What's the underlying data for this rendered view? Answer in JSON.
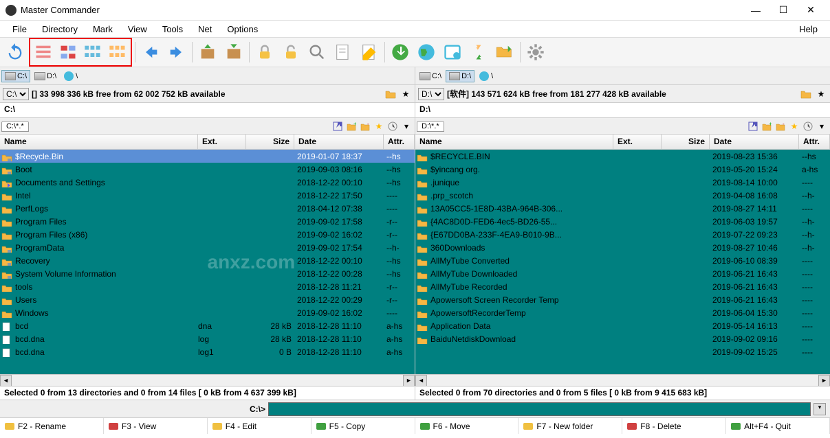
{
  "app": {
    "title": "Master Commander"
  },
  "menu": [
    "File",
    "Directory",
    "Mark",
    "View",
    "Tools",
    "Net",
    "Options"
  ],
  "menuRight": "Help",
  "left": {
    "drives": [
      {
        "label": "C:\\",
        "active": true
      },
      {
        "label": "D:\\",
        "active": false
      },
      {
        "label": "\\",
        "active": false,
        "net": true
      }
    ],
    "driveSel": "C:\\",
    "free": "[] 33 998 336 kB free from 62 002 752 kB available",
    "bread": "C:\\",
    "tab": "C:\\*.*",
    "cols": {
      "name": "Name",
      "ext": "Ext.",
      "size": "Size",
      "date": "Date",
      "attr": "Attr."
    },
    "rows": [
      {
        "icon": "folder-sys",
        "name": "$Recycle.Bin",
        "ext": "",
        "size": "<Dir>",
        "date": "2019-01-07 18:37",
        "attr": "--hs",
        "sel": true
      },
      {
        "icon": "folder-sys",
        "name": "Boot",
        "ext": "",
        "size": "<Dir>",
        "date": "2019-09-03 08:16",
        "attr": "--hs"
      },
      {
        "icon": "folder-link",
        "name": "Documents and Settings",
        "ext": "",
        "size": "<Link>",
        "date": "2018-12-22 00:10",
        "attr": "--hs"
      },
      {
        "icon": "folder",
        "name": "Intel",
        "ext": "",
        "size": "<Dir>",
        "date": "2018-12-22 17:50",
        "attr": "----"
      },
      {
        "icon": "folder",
        "name": "PerfLogs",
        "ext": "",
        "size": "<Dir>",
        "date": "2018-04-12 07:38",
        "attr": "----"
      },
      {
        "icon": "folder",
        "name": "Program Files",
        "ext": "",
        "size": "<Dir>",
        "date": "2019-09-02 17:58",
        "attr": "-r--"
      },
      {
        "icon": "folder",
        "name": "Program Files (x86)",
        "ext": "",
        "size": "<Dir>",
        "date": "2019-09-02 16:02",
        "attr": "-r--"
      },
      {
        "icon": "folder-sys",
        "name": "ProgramData",
        "ext": "",
        "size": "<Dir>",
        "date": "2019-09-02 17:54",
        "attr": "--h-"
      },
      {
        "icon": "folder-sys",
        "name": "Recovery",
        "ext": "",
        "size": "<Dir>",
        "date": "2018-12-22 00:10",
        "attr": "--hs"
      },
      {
        "icon": "folder-sys",
        "name": "System Volume Information",
        "ext": "",
        "size": "<Dir>",
        "date": "2018-12-22 00:28",
        "attr": "--hs"
      },
      {
        "icon": "folder",
        "name": "tools",
        "ext": "",
        "size": "<Dir>",
        "date": "2018-12-28 11:21",
        "attr": "-r--"
      },
      {
        "icon": "folder",
        "name": "Users",
        "ext": "",
        "size": "<Dir>",
        "date": "2018-12-22 00:29",
        "attr": "-r--"
      },
      {
        "icon": "folder",
        "name": "Windows",
        "ext": "",
        "size": "<Dir>",
        "date": "2019-09-02 16:02",
        "attr": "----"
      },
      {
        "icon": "file",
        "name": "bcd",
        "ext": "dna",
        "size": "28 kB",
        "date": "2018-12-28 11:10",
        "attr": "a-hs"
      },
      {
        "icon": "file",
        "name": "bcd.dna",
        "ext": "log",
        "size": "28 kB",
        "date": "2018-12-28 11:10",
        "attr": "a-hs"
      },
      {
        "icon": "file",
        "name": "bcd.dna",
        "ext": "log1",
        "size": "0 B",
        "date": "2018-12-28 11:10",
        "attr": "a-hs"
      }
    ],
    "status": "Selected 0 from 13 directories and 0 from 14 files [ 0 kB from 4 637 399 kB]"
  },
  "right": {
    "drives": [
      {
        "label": "C:\\",
        "active": false
      },
      {
        "label": "D:\\",
        "active": true
      },
      {
        "label": "\\",
        "active": false,
        "net": true
      }
    ],
    "driveSel": "D:\\",
    "free": "[软件] 143 571 624 kB free from 181 277 428 kB available",
    "bread": "D:\\",
    "tab": "D:\\*.*",
    "cols": {
      "name": "Name",
      "ext": "Ext.",
      "size": "Size",
      "date": "Date",
      "attr": "Attr."
    },
    "rows": [
      {
        "icon": "folder",
        "name": "$RECYCLE.BIN",
        "ext": "",
        "size": "<Dir>",
        "date": "2019-08-23 15:36",
        "attr": "--hs"
      },
      {
        "icon": "folder",
        "name": "$yincang org.",
        "ext": "",
        "size": "<Dir>",
        "date": "2019-05-20 15:24",
        "attr": "a-hs"
      },
      {
        "icon": "folder",
        "name": ".junique",
        "ext": "",
        "size": "<Dir>",
        "date": "2019-08-14 10:00",
        "attr": "----"
      },
      {
        "icon": "folder",
        "name": ".prp_scotch",
        "ext": "",
        "size": "<Dir>",
        "date": "2019-04-08 16:08",
        "attr": "--h-"
      },
      {
        "icon": "folder",
        "name": "13A05CC5-1E8D-43BA-964B-306...",
        "ext": "",
        "size": "<Dir>",
        "date": "2019-08-27 14:11",
        "attr": "----"
      },
      {
        "icon": "folder",
        "name": "{4AC8D0D-FED6-4ec5-BD26-55...",
        "ext": "",
        "size": "<Dir>",
        "date": "2019-06-03 19:57",
        "attr": "--h-"
      },
      {
        "icon": "folder",
        "name": "{E67DD0BA-233F-4EA9-B010-9B...",
        "ext": "",
        "size": "<Dir>",
        "date": "2019-07-22 09:23",
        "attr": "--h-"
      },
      {
        "icon": "folder",
        "name": "360Downloads",
        "ext": "",
        "size": "<Dir>",
        "date": "2019-08-27 10:46",
        "attr": "--h-"
      },
      {
        "icon": "folder",
        "name": "AllMyTube Converted",
        "ext": "",
        "size": "<Dir>",
        "date": "2019-06-10 08:39",
        "attr": "----"
      },
      {
        "icon": "folder",
        "name": "AllMyTube Downloaded",
        "ext": "",
        "size": "<Dir>",
        "date": "2019-06-21 16:43",
        "attr": "----"
      },
      {
        "icon": "folder",
        "name": "AllMyTube Recorded",
        "ext": "",
        "size": "<Dir>",
        "date": "2019-06-21 16:43",
        "attr": "----"
      },
      {
        "icon": "folder",
        "name": "Apowersoft Screen Recorder Temp",
        "ext": "",
        "size": "<Dir>",
        "date": "2019-06-21 16:43",
        "attr": "----"
      },
      {
        "icon": "folder",
        "name": "ApowersoftRecorderTemp",
        "ext": "",
        "size": "<Dir>",
        "date": "2019-06-04 15:30",
        "attr": "----"
      },
      {
        "icon": "folder",
        "name": "Application Data",
        "ext": "",
        "size": "<Dir>",
        "date": "2019-05-14 16:13",
        "attr": "----"
      },
      {
        "icon": "folder",
        "name": "BaiduNetdiskDownload",
        "ext": "",
        "size": "<Dir>",
        "date": "2019-09-02 09:16",
        "attr": "----"
      },
      {
        "icon": "folder",
        "name": "",
        "ext": "",
        "size": "<Dir>",
        "date": "2019-09-02 15:25",
        "attr": "----"
      }
    ],
    "status": "Selected 0 from 70 directories and 0 from 5 files [ 0 kB from 9 415 683 kB]"
  },
  "cmdPrompt": "C:\\>",
  "fkeys": [
    {
      "key": "F2",
      "label": "Rename",
      "color": "#f0c040"
    },
    {
      "key": "F3",
      "label": "View",
      "color": "#d04040"
    },
    {
      "key": "F4",
      "label": "Edit",
      "color": "#f0c040"
    },
    {
      "key": "F5",
      "label": "Copy",
      "color": "#40a040"
    },
    {
      "key": "F6",
      "label": "Move",
      "color": "#40a040"
    },
    {
      "key": "F7",
      "label": "New folder",
      "color": "#f0c040"
    },
    {
      "key": "F8",
      "label": "Delete",
      "color": "#d04040"
    },
    {
      "key": "Alt+F4",
      "label": "Quit",
      "color": "#40a040"
    }
  ]
}
